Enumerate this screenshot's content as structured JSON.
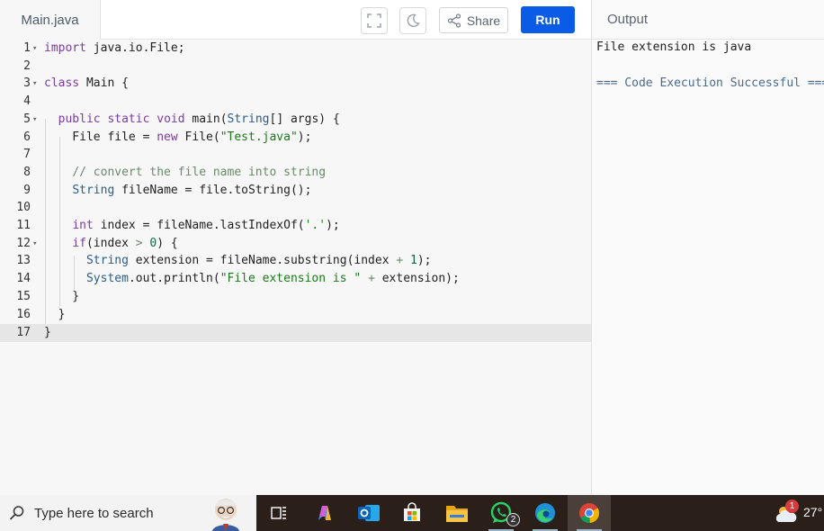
{
  "editor": {
    "file_tab": "Main.java",
    "share_label": "Share",
    "run_label": "Run",
    "line_numbers": [
      "1",
      "2",
      "3",
      "4",
      "5",
      "6",
      "7",
      "8",
      "9",
      "10",
      "11",
      "12",
      "13",
      "14",
      "15",
      "16",
      "17"
    ]
  },
  "output": {
    "title": "Output",
    "lines": [
      "File extension is java",
      "",
      "=== Code Execution Successful ==="
    ]
  },
  "taskbar": {
    "search_placeholder": "Type here to search",
    "whatsapp_badge": "2",
    "weather_badge": "1",
    "temperature": "27°"
  },
  "colors": {
    "run_button": "#0a5ce6",
    "taskbar": "#2a1f19"
  }
}
